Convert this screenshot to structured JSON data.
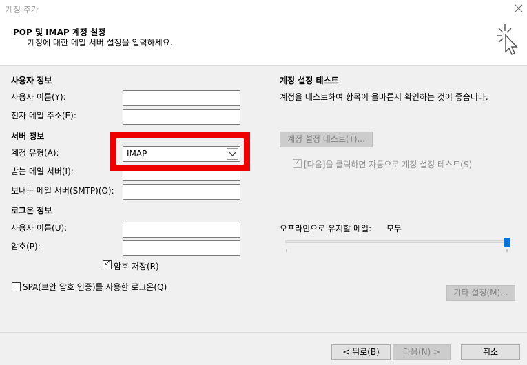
{
  "window": {
    "title": "계정 추가"
  },
  "header": {
    "title": "POP 및 IMAP 계정 설정",
    "subtitle": "계정에 대한 메일 서버 설정을 입력하세요."
  },
  "user_info": {
    "section": "사용자 정보",
    "name_label": "사용자 이름(Y):",
    "name_value": "",
    "email_label": "전자 메일 주소(E):",
    "email_value": ""
  },
  "server_info": {
    "section": "서버 정보",
    "account_type_label": "계정 유형(A):",
    "account_type_value": "IMAP",
    "incoming_label": "받는 메일 서버(I):",
    "incoming_value": "",
    "outgoing_label": "보내는 메일 서버(SMTP)(O):",
    "outgoing_value": ""
  },
  "login_info": {
    "section": "로그온 정보",
    "username_label": "사용자 이름(U):",
    "username_value": "",
    "password_label": "암호(P):",
    "password_value": "",
    "save_password_label": "암호 저장(R)",
    "save_password_checked": true,
    "spa_label": "SPA(보안 암호 인증)를 사용한 로그온(Q)",
    "spa_checked": false
  },
  "test": {
    "section": "계정 설정 테스트",
    "description": "계정을 테스트하여 항목이 올바른지 확인하는 것이 좋습니다.",
    "test_button": "계정 설정 테스트(T)...",
    "auto_test_label": "[다음]을 클릭하면 자동으로 계정 설정 테스트(S)",
    "auto_test_checked": true
  },
  "offline": {
    "label": "오프라인으로 유지할 메일:",
    "value": "모두",
    "slider_fraction": 1.0
  },
  "more_settings_button": "기타 설정(M)...",
  "footer": {
    "back": "< 뒤로(B)",
    "next": "다음(N) >",
    "cancel": "취소"
  },
  "colors": {
    "highlight": "#ee0000",
    "slider": "#0a74d8"
  }
}
